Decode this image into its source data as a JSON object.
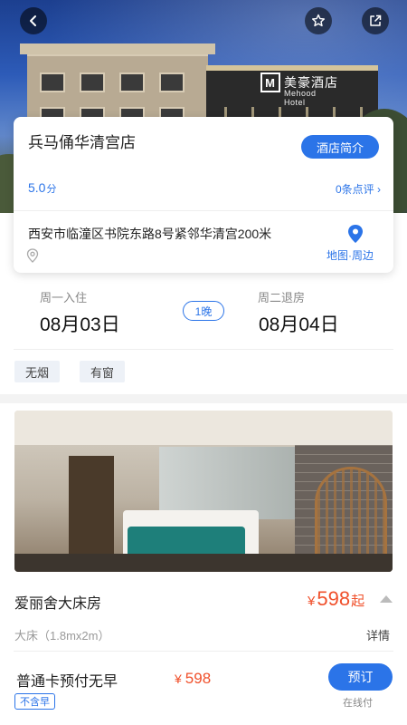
{
  "hero": {
    "sign_logo": "M",
    "sign_text": "美豪酒店",
    "sign_sub": "Mehood Hotel"
  },
  "toolbar": {
    "back_icon": "chevron-left-icon",
    "favorite_icon": "star-icon",
    "share_icon": "share-icon"
  },
  "hotel": {
    "name": "兵马俑华清宫店",
    "intro_button": "酒店简介",
    "score": "5.0",
    "score_unit": "分",
    "reviews": "0条点评 ›",
    "address": "西安市临潼区书院东路8号紧邻华清宫200米",
    "map_label": "地图·周边"
  },
  "stay": {
    "checkin_label": "周一入住",
    "checkin_date": "08月03日",
    "nights": "1晚",
    "checkout_label": "周二退房",
    "checkout_date": "08月04日"
  },
  "tags": [
    "无烟",
    "有窗"
  ],
  "room": {
    "name": "爱丽舍大床房",
    "price_symbol": "¥",
    "price": "598",
    "price_suffix": "起",
    "bed": "大床（1.8mx2m）",
    "details": "详情"
  },
  "plan": {
    "name": "普通卡预付无早",
    "price_symbol": "¥",
    "price": "598",
    "breakfast_tag": "不含早",
    "book_button": "预订",
    "payment_note": "在线付"
  },
  "colors": {
    "accent": "#2b74e8",
    "price": "#f0502b"
  }
}
